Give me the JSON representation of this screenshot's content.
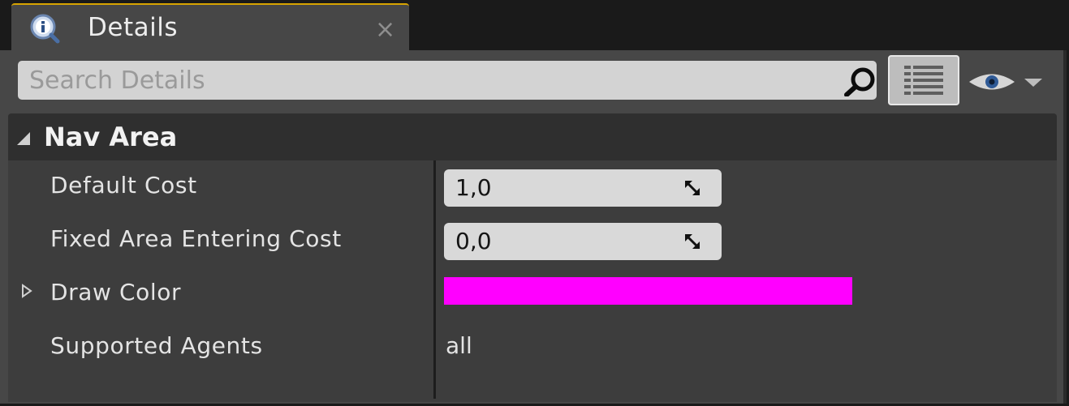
{
  "tab": {
    "title": "Details",
    "icon": "info-icon",
    "close_symbol": "×",
    "accent_color": "#d8a400"
  },
  "search": {
    "placeholder": "Search Details",
    "value": "",
    "icon": "search-icon"
  },
  "toolbar": {
    "view_options_icon": "list-view-icon",
    "visibility_icon": "eye-icon",
    "dropdown_icon": "chevron-down-icon"
  },
  "category": {
    "title": "Nav Area",
    "expanded": true
  },
  "properties": [
    {
      "name": "Default Cost",
      "type": "number",
      "value": "1,0"
    },
    {
      "name": "Fixed Area Entering Cost",
      "type": "number",
      "value": "0,0"
    },
    {
      "name": "Draw Color",
      "type": "color",
      "color": "#ff00ff",
      "expandable": true
    },
    {
      "name": "Supported Agents",
      "type": "text",
      "value": "all"
    }
  ]
}
